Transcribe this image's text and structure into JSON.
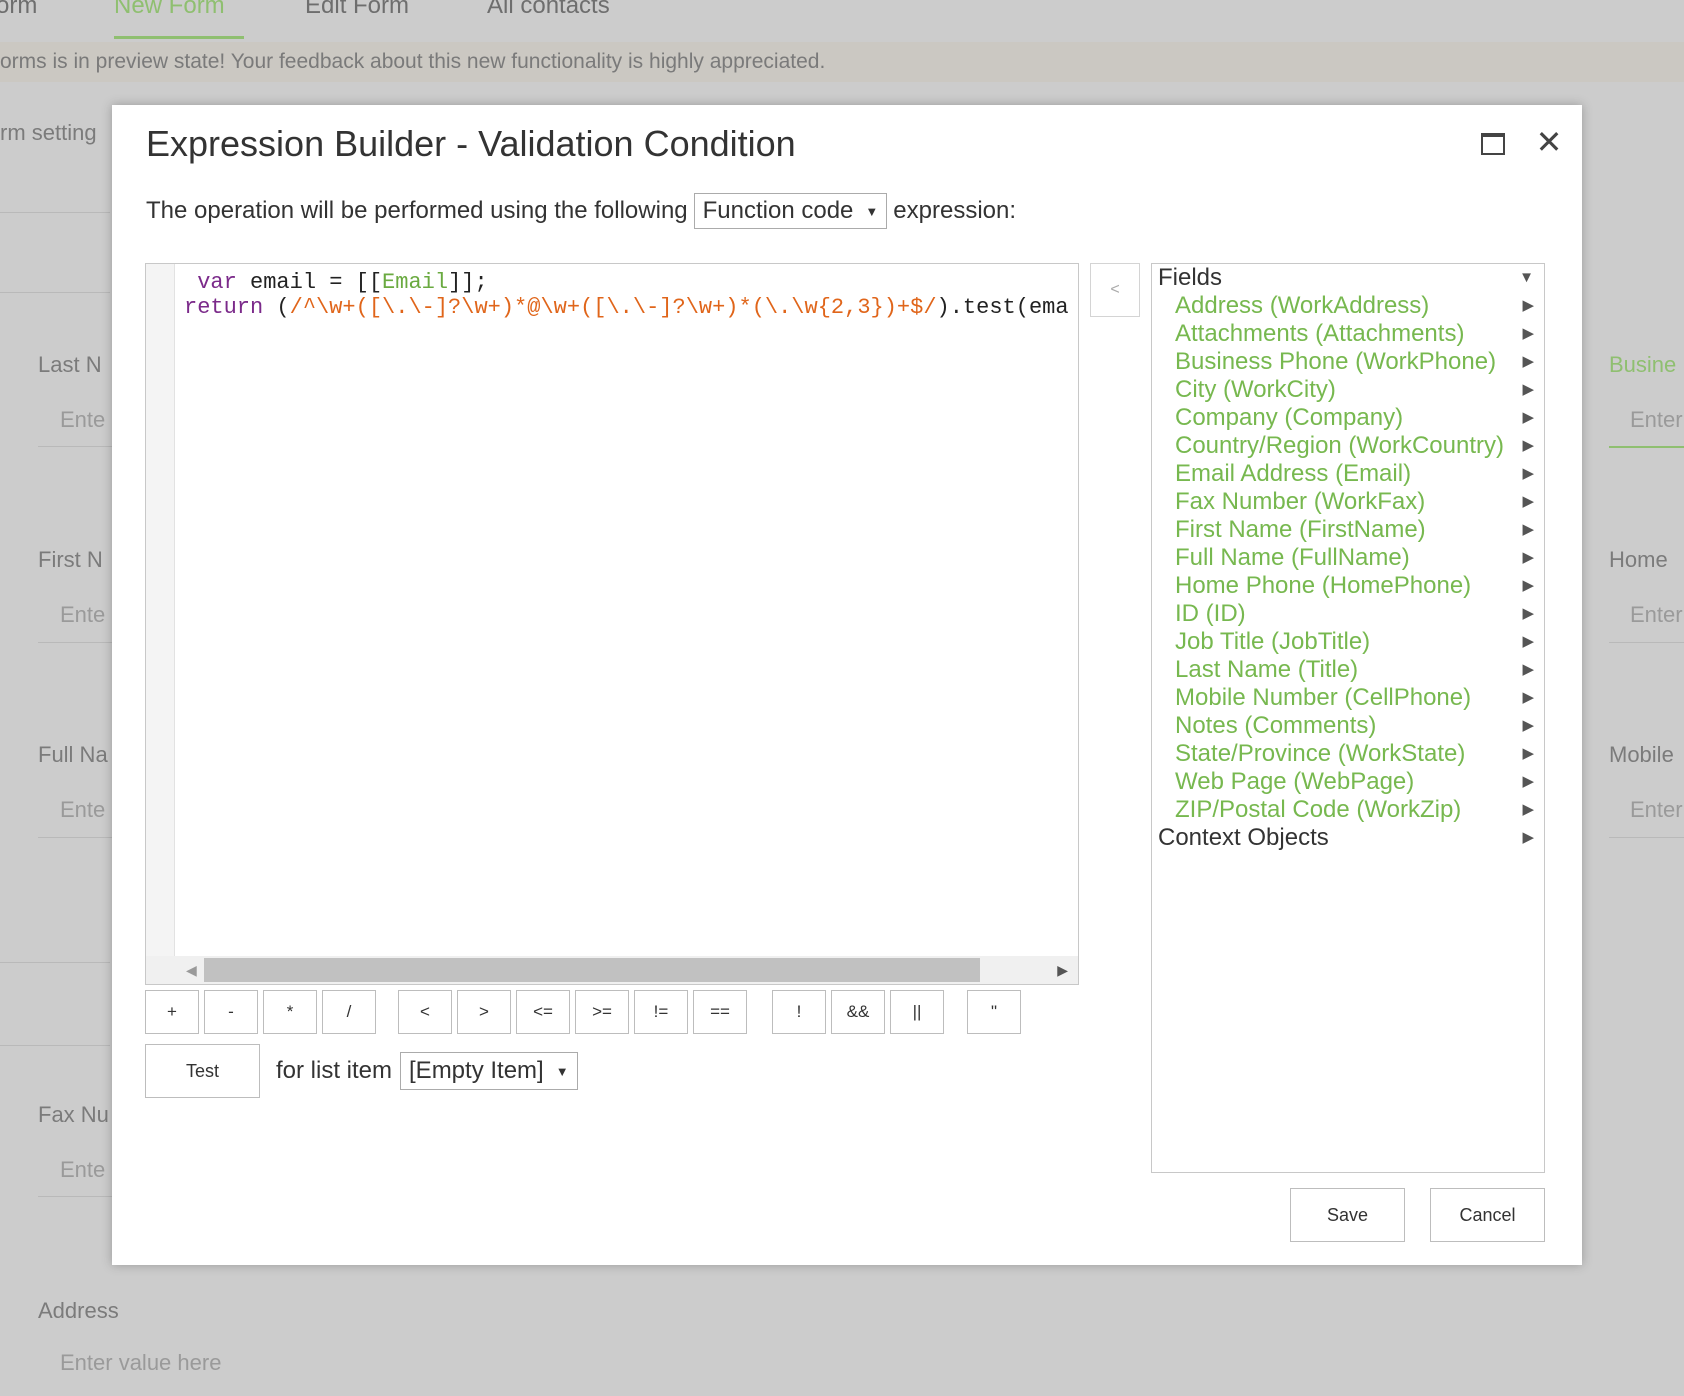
{
  "background": {
    "tabs": [
      "orm",
      "New Form",
      "Edit Form",
      "All contacts"
    ],
    "banner": "orms is in preview state! Your feedback about this new functionality is highly appreciated.",
    "settings_label": "rm setting",
    "left_labels": [
      "Last N",
      "First N",
      "Full Na",
      "Fax Nu",
      "Address"
    ],
    "left_placeholders": [
      "Ente",
      "Ente",
      "Ente",
      "Ente",
      "Enter value here"
    ],
    "right_labels": [
      "Busine",
      "Home",
      "Mobile"
    ],
    "right_placeholders": [
      "Enter",
      "Enter",
      "Enter"
    ]
  },
  "dialog": {
    "title": "Expression Builder - Validation Condition",
    "maximize_icon": "maximize-icon",
    "close_icon": "close-icon",
    "op_prefix": "The operation will be performed using the following",
    "op_select": "Function code",
    "op_suffix": "expression:",
    "code": {
      "line1_kw": "var",
      "line1_a": " email = [[",
      "line1_field": "Email",
      "line1_b": "]];",
      "line2_kw": "return",
      "line2_a": " (",
      "line2_regex": "/^\\w+([\\.\\-]?\\w+)*@\\w+([\\.\\-]?\\w+)*(\\.\\w{2,3})+$/",
      "line2_b": ").test(ema"
    },
    "collapse_label": "<",
    "operators": [
      "+",
      "-",
      "*",
      "/",
      "<",
      ">",
      "<=",
      ">=",
      "!=",
      "==",
      "!",
      "&&",
      "||",
      "\""
    ],
    "test_label": "Test",
    "for_list_item": "for list item",
    "list_item_select": "[Empty Item]",
    "save_label": "Save",
    "cancel_label": "Cancel"
  },
  "fields_panel": {
    "header": "Fields",
    "items": [
      "Address (WorkAddress)",
      "Attachments (Attachments)",
      "Business Phone (WorkPhone)",
      "City (WorkCity)",
      "Company (Company)",
      "Country/Region (WorkCountry)",
      "Email Address (Email)",
      "Fax Number (WorkFax)",
      "First Name (FirstName)",
      "Full Name (FullName)",
      "Home Phone (HomePhone)",
      "ID (ID)",
      "Job Title (JobTitle)",
      "Last Name (Title)",
      "Mobile Number (CellPhone)",
      "Notes (Comments)",
      "State/Province (WorkState)",
      "Web Page (WebPage)",
      "ZIP/Postal Code (WorkZip)"
    ],
    "context": "Context Objects",
    "colors": {
      "field": "#77b84f",
      "accent": "#8fbf70"
    }
  }
}
